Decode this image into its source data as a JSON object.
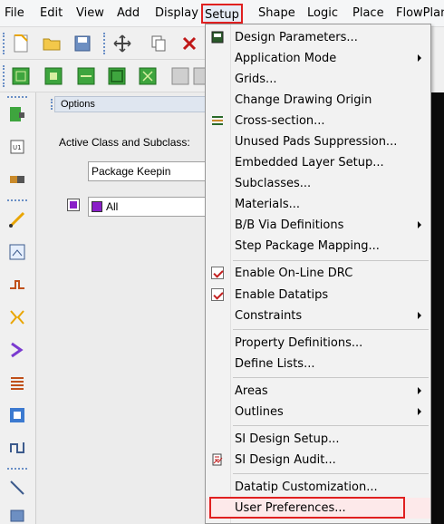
{
  "menubar": {
    "items": [
      "File",
      "Edit",
      "View",
      "Add",
      "Display",
      "Setup",
      "Shape",
      "Logic",
      "Place",
      "FlowPlan"
    ]
  },
  "options": {
    "title": "Options",
    "active_class_label": "Active Class and Subclass:",
    "class_value": "Package Keepin",
    "subclass_value": "All"
  },
  "setup_menu": {
    "items": [
      {
        "label": "Design Parameters...",
        "submenu": false
      },
      {
        "label": "Application Mode",
        "submenu": true
      },
      {
        "label": "Grids...",
        "submenu": false
      },
      {
        "label": "Change Drawing Origin",
        "submenu": false
      },
      {
        "label": "Cross-section...",
        "submenu": false
      },
      {
        "label": "Unused Pads Suppression...",
        "submenu": false
      },
      {
        "label": "Embedded Layer Setup...",
        "submenu": false
      },
      {
        "label": "Subclasses...",
        "submenu": false
      },
      {
        "label": "Materials...",
        "submenu": false
      },
      {
        "label": "B/B Via Definitions",
        "submenu": true
      },
      {
        "label": "Step Package Mapping...",
        "submenu": false
      },
      {
        "label": "Enable On-Line DRC",
        "checked": true
      },
      {
        "label": "Enable Datatips",
        "checked": true
      },
      {
        "label": "Constraints",
        "submenu": true
      },
      {
        "label": "Property Definitions...",
        "submenu": false
      },
      {
        "label": "Define Lists...",
        "submenu": false
      },
      {
        "label": "Areas",
        "submenu": true
      },
      {
        "label": "Outlines",
        "submenu": true
      },
      {
        "label": "SI Design Setup...",
        "submenu": false
      },
      {
        "label": "SI Design Audit...",
        "submenu": false
      },
      {
        "label": "Datatip Customization...",
        "submenu": false
      },
      {
        "label": "User Preferences...",
        "submenu": false,
        "highlighted": true
      }
    ]
  },
  "colors": {
    "highlight_box": "#e02020",
    "subclass_color": "#8a1fc8"
  }
}
